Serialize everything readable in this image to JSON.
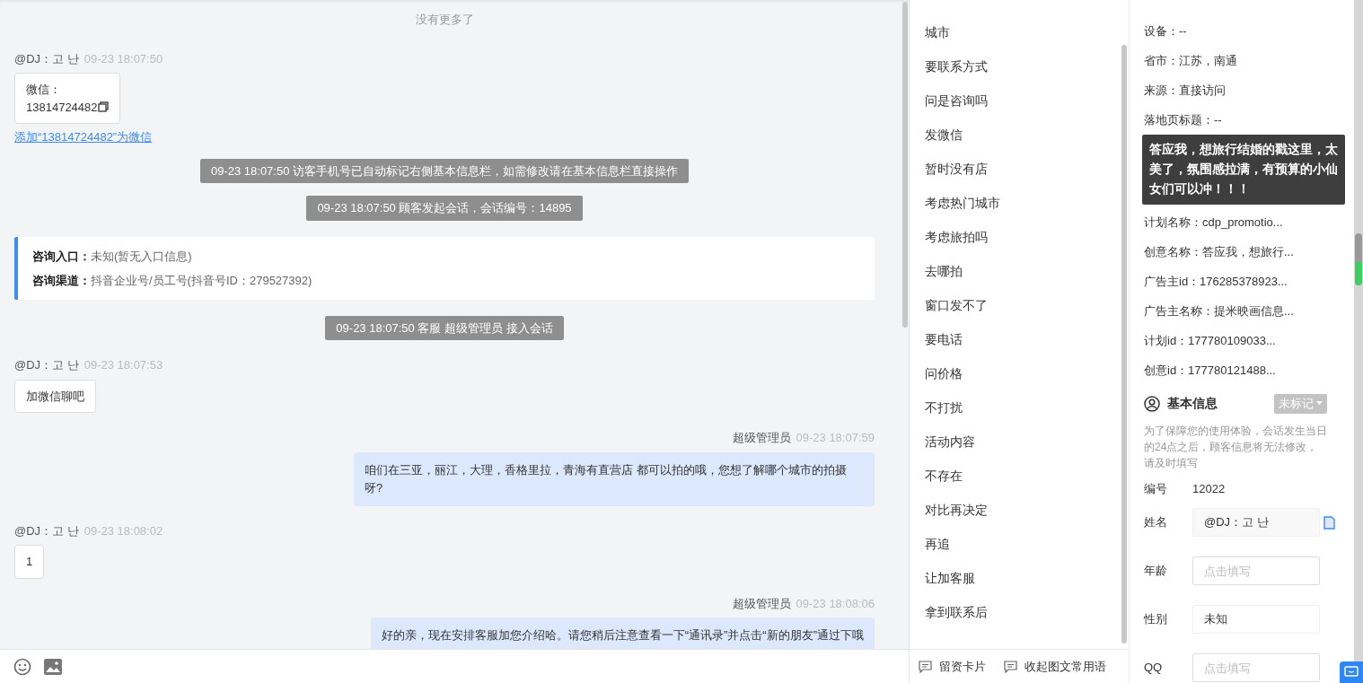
{
  "chat": {
    "no_more": "没有更多了",
    "messages": [
      {
        "kind": "visitor",
        "sender": "@DJ：고 난",
        "time": "09-23 18:07:50",
        "card": {
          "label": "微信：",
          "value": "13814724482"
        },
        "link": "添加“13814724482”为微信"
      },
      {
        "kind": "system",
        "text": "09-23 18:07:50 访客手机号已自动标记右侧基本信息栏，如需修改请在基本信息栏直接操作"
      },
      {
        "kind": "system",
        "text": "09-23 18:07:50 顾客发起会话，会话编号：14895"
      },
      {
        "kind": "entry",
        "rows": [
          {
            "label": "咨询入口：",
            "value": "未知(暂无入口信息)"
          },
          {
            "label": "咨询渠道：",
            "value": "抖音企业号/员工号(抖音号ID：279527392)"
          }
        ]
      },
      {
        "kind": "system",
        "text": "09-23 18:07:50 客服 超级管理员 接入会话"
      },
      {
        "kind": "visitor",
        "sender": "@DJ：고 난",
        "time": "09-23 18:07:53",
        "text": "加微信聊吧"
      },
      {
        "kind": "agent",
        "sender": "超级管理员",
        "time": "09-23 18:07:59",
        "text": "咱们在三亚，丽江，大理，香格里拉，青海有直营店 都可以拍的哦，您想了解哪个城市的拍摄呀?"
      },
      {
        "kind": "visitor",
        "sender": "@DJ：고 난",
        "time": "09-23 18:08:02",
        "text": "1"
      },
      {
        "kind": "agent",
        "sender": "超级管理员",
        "time": "09-23 18:08:06",
        "text": "好的亲，现在安排客服加您介绍哈。请您稍后注意查看一下“通讯录”并点击“新的朋友”通过下哦"
      }
    ]
  },
  "quick_phrases": {
    "items": [
      "城市",
      "要联系方式",
      "问是咨询吗",
      "发微信",
      "暂时没有店",
      "考虑热门城市",
      "考虑旅拍吗",
      "去哪拍",
      "窗口发不了",
      "要电话",
      "问价格",
      "不打扰",
      "活动内容",
      "不存在",
      "对比再决定",
      "再追",
      "让加客服",
      "拿到联系后"
    ],
    "actions": [
      "留资卡片",
      "收起图文常用语"
    ]
  },
  "source_info": {
    "rows": [
      {
        "text": "设备：--"
      },
      {
        "text": "省市：江苏，南通"
      },
      {
        "text": "来源：直接访问"
      },
      {
        "text": "落地页标题：--"
      },
      {
        "text": "计划名称：cdp_promotio..."
      },
      {
        "text": "创意名称：答应我，想旅行..."
      },
      {
        "text": "广告主id：176285378923..."
      },
      {
        "text": "广告主名称：提米映画信息..."
      },
      {
        "text": "计划id：177780109033..."
      },
      {
        "text": "创意id：177780121488..."
      }
    ],
    "tooltip": "答应我，想旅行结婚的戳这里，太美了，氛围感拉满，有预算的小仙女们可以冲！！！"
  },
  "basic_info": {
    "title": "基本信息",
    "tag": "未标记",
    "notice": "为了保障您的使用体验，会话发生当日的24点之后，顾客信息将无法修改，请及时填写",
    "fields": [
      {
        "label": "编号",
        "kind": "text",
        "value": "12022"
      },
      {
        "label": "姓名",
        "kind": "readonly",
        "value": "@DJ：고 난"
      },
      {
        "label": "年龄",
        "kind": "input",
        "placeholder": "点击填写"
      },
      {
        "label": "性别",
        "kind": "select",
        "value": "未知"
      },
      {
        "label": "QQ",
        "kind": "input",
        "placeholder": "点击填写"
      }
    ]
  }
}
